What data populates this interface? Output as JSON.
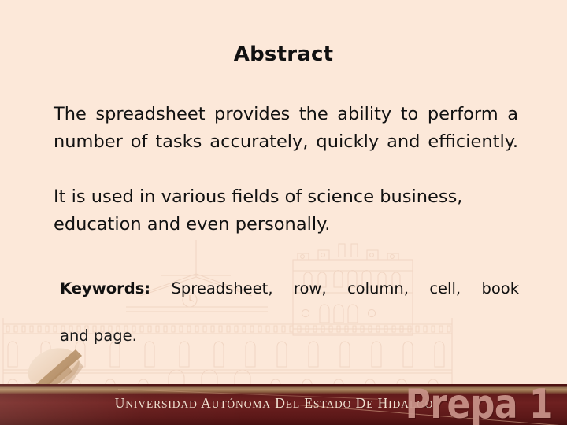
{
  "slide": {
    "title": "Abstract",
    "background_color": "#fce8d9",
    "text_color": "#111111"
  },
  "body": {
    "paragraph_1": "The spreadsheet provides the ability to perform a number of tasks accurately, quickly and efficiently.",
    "paragraph_2": "It is used in various fields of science business, education and even personally."
  },
  "keywords": {
    "label": "Keywords:",
    "list": "Spreadsheet, row, column, cell, book",
    "continuation": "and page."
  },
  "footer": {
    "institution_prefix": "U",
    "institution": "UNIVERSIDAD AUTÓNOMA DEL ESTADO DE HIDALGO",
    "logo_text": "Prepa 1",
    "bar_color": "#611b1b",
    "accent_color": "#b08a63",
    "institution_text_color": "#f4e2d2",
    "logo_text_color": "#c9948a"
  },
  "watermark": {
    "description": "university-building-facade",
    "line_color": "#f0d5c2"
  }
}
